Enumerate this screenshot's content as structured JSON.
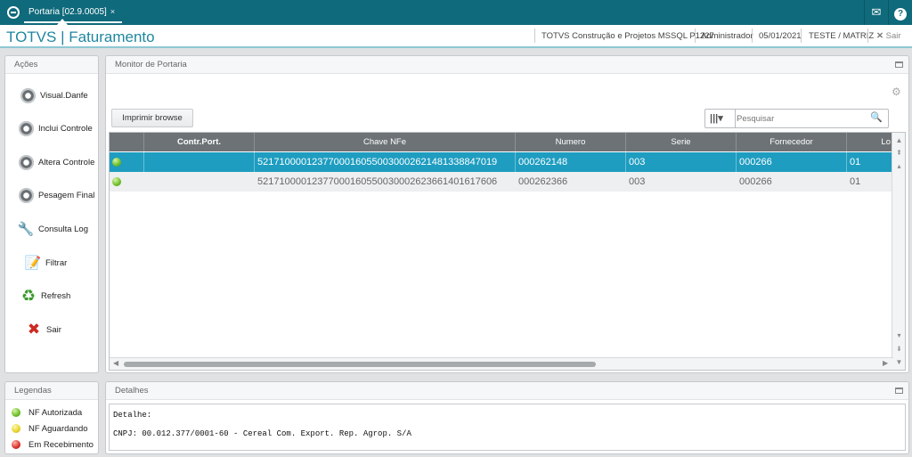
{
  "topbar": {
    "tab_label": "Portaria [02.9.0005]",
    "tab_close": "×",
    "mail_icon": "envelope-icon",
    "help_icon": "help-icon",
    "mail_glyph": "✉",
    "help_glyph": "?"
  },
  "header": {
    "title": "TOTVS | Faturamento",
    "company": "TOTVS Construção e Projetos MSSQL P1227",
    "user": "Administrador",
    "date": "05/01/2021",
    "branch": "TESTE / MATRIZ",
    "exit_label": "Sair",
    "exit_glyph": "✕"
  },
  "actions": {
    "title": "Ações",
    "items": [
      {
        "label": "Visual.Danfe",
        "icon": "gear-icon"
      },
      {
        "label": "Inclui Controle",
        "icon": "gear-icon"
      },
      {
        "label": "Altera Controle",
        "icon": "gear-icon"
      },
      {
        "label": "Pesagem Final",
        "icon": "gear-icon"
      },
      {
        "label": "Consulta Log",
        "icon": "tools-icon",
        "glyph": "🔧"
      },
      {
        "label": "Filtrar",
        "icon": "filter-icon",
        "glyph": "📝"
      },
      {
        "label": "Refresh",
        "icon": "refresh-icon",
        "glyph": "♻"
      },
      {
        "label": "Sair",
        "icon": "close-icon",
        "glyph": "✖"
      }
    ]
  },
  "monitor": {
    "title": "Monitor de Portaria",
    "print_button": "Imprimir browse",
    "search_placeholder": "Pesquisar",
    "columns_glyph": "|||▾",
    "search_glyph": "🔍",
    "settings_glyph": "⚙",
    "columns": [
      "",
      "Contr.Port.",
      "Chave NFe",
      "Numero",
      "Serie",
      "Fornecedor",
      "Lo"
    ],
    "rows": [
      {
        "status": "green",
        "contr": "",
        "chave": "52171000012377000160550030002621481338847019",
        "numero": "000262148",
        "serie": "003",
        "fornecedor": "000266",
        "loja": "01",
        "selected": true
      },
      {
        "status": "green",
        "contr": "",
        "chave": "52171000012377000160550030002623661401617606",
        "numero": "000262366",
        "serie": "003",
        "fornecedor": "000266",
        "loja": "01",
        "selected": false
      }
    ]
  },
  "legend": {
    "title": "Legendas",
    "items": [
      {
        "label": "NF Autorizada",
        "color": "#6cbd28"
      },
      {
        "label": "NF Aguardando",
        "color": "#e8d42a"
      },
      {
        "label": "Em Recebimento",
        "color": "#d9302c"
      }
    ]
  },
  "details": {
    "title": "Detalhes",
    "line1": "Detalhe:",
    "line2": "CNPJ: 00.012.377/0001-60 - Cereal Com. Export. Rep. Agrop. S/A"
  },
  "colors": {
    "accent": "#0f6a7b",
    "selection": "#1e9dc0",
    "grid_header": "#6c7276"
  }
}
